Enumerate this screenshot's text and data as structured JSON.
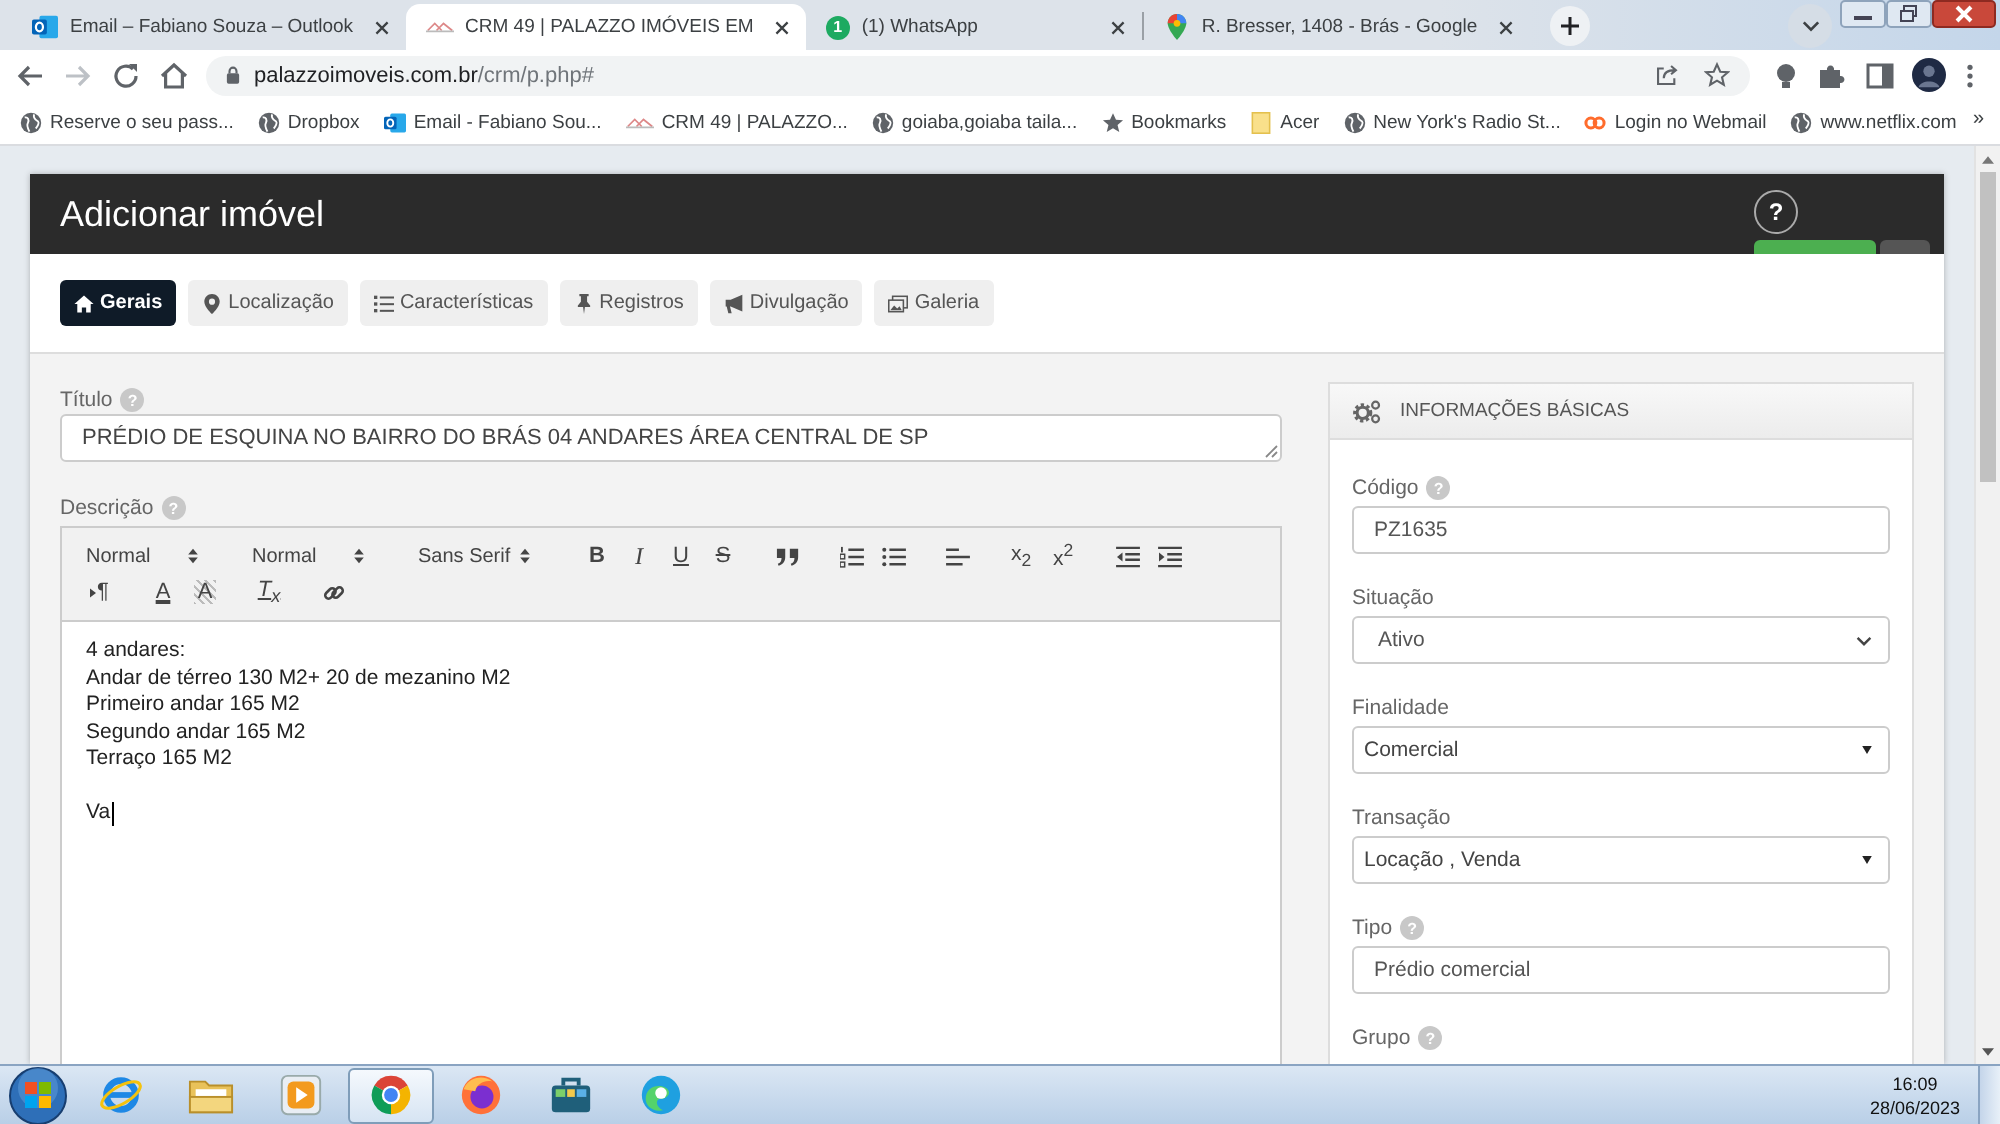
{
  "browser": {
    "tabs": [
      {
        "title": "Email – Fabiano Souza – Outlook",
        "selected": false
      },
      {
        "title": "CRM 49 | PALAZZO IMÓVEIS EM",
        "selected": true
      },
      {
        "title": "(1) WhatsApp",
        "selected": false,
        "badge": "1"
      },
      {
        "title": "R. Bresser, 1408 - Brás - Google",
        "selected": false
      }
    ],
    "url": {
      "host": "palazzoimoveis.com.br",
      "path": "/crm/p.php#"
    },
    "bookmarks": [
      {
        "label": "Reserve o seu pass..."
      },
      {
        "label": "Dropbox"
      },
      {
        "label": "Email - Fabiano Sou..."
      },
      {
        "label": "CRM 49 | PALAZZO..."
      },
      {
        "label": "goiaba,goiaba taila..."
      },
      {
        "label": "Bookmarks"
      },
      {
        "label": "Acer"
      },
      {
        "label": "New York's Radio St..."
      },
      {
        "label": "Login no Webmail"
      },
      {
        "label": "www.netflix.com"
      }
    ],
    "more_bookmarks": "»"
  },
  "modal": {
    "title": "Adicionar imóvel",
    "help": "?",
    "tabs": [
      {
        "label": "Gerais",
        "selected": true
      },
      {
        "label": "Localização",
        "selected": false
      },
      {
        "label": "Características",
        "selected": false
      },
      {
        "label": "Registros",
        "selected": false
      },
      {
        "label": "Divulgação",
        "selected": false
      },
      {
        "label": "Galeria",
        "selected": false
      }
    ]
  },
  "form": {
    "title_field": {
      "label": "Título",
      "help": "?",
      "value": "PRÉDIO DE ESQUINA NO BAIRRO DO BRÁS 04 ANDARES ÁREA CENTRAL DE SP"
    },
    "description": {
      "label": "Descrição",
      "help": "?",
      "toolbar_rows": [
        [
          [
            {
              "kind": "picker",
              "label": "Normal"
            }
          ],
          [
            {
              "kind": "picker",
              "label": "Normal"
            }
          ],
          [
            {
              "kind": "picker",
              "label": "Sans Serif"
            }
          ],
          [
            {
              "kind": "bold",
              "label": "B"
            },
            {
              "kind": "italic",
              "label": "I"
            },
            {
              "kind": "underline",
              "label": "U"
            },
            {
              "kind": "strike",
              "label": "S"
            }
          ],
          [
            {
              "kind": "blockquote"
            }
          ],
          [
            {
              "kind": "list-ordered"
            },
            {
              "kind": "list-bullet"
            }
          ],
          [
            {
              "kind": "align"
            }
          ],
          [
            {
              "kind": "subscript",
              "label": "x$_{2}$"
            },
            {
              "kind": "superscript",
              "label": "x$^{2}$"
            }
          ],
          [
            {
              "kind": "outdent"
            },
            {
              "kind": "indent"
            }
          ]
        ],
        [
          [
            {
              "kind": "direction",
              "label": "¶"
            }
          ],
          [
            {
              "kind": "color",
              "label": "A"
            },
            {
              "kind": "background",
              "label": "A"
            }
          ],
          [
            {
              "kind": "clean",
              "label": "T$_{x}$"
            }
          ],
          [
            {
              "kind": "link"
            }
          ]
        ]
      ],
      "paragraphs": [
        [
          "4 andares:",
          "Andar de térreo 130 M2+ 20 de mezanino M2",
          "Primeiro andar 165 M2",
          "Segundo andar 165 M2",
          "Terraço 165 M2"
        ],
        [
          "Va"
        ]
      ],
      "focused": true
    }
  },
  "info_panel": {
    "title": "INFORMAÇÕES BÁSICAS",
    "fields": [
      {
        "label": "Código",
        "help": "?",
        "kind": "input",
        "value": "PZ1635"
      },
      {
        "label": "Situação",
        "kind": "select",
        "value": "Ativo"
      },
      {
        "label": "Finalidade",
        "kind": "dropdown",
        "value": "Comercial"
      },
      {
        "label": "Transação",
        "kind": "dropdown",
        "value": "Locação , Venda"
      },
      {
        "label": "Tipo",
        "help": "?",
        "kind": "input",
        "value": "Prédio comercial"
      },
      {
        "label": "Grupo",
        "help": "?"
      }
    ]
  },
  "taskbar": {
    "apps": [
      {
        "selected": false
      },
      {
        "selected": false
      },
      {
        "selected": false
      },
      {
        "selected": true
      },
      {
        "selected": false
      },
      {
        "selected": false
      },
      {
        "selected": false
      }
    ],
    "time": "16:09",
    "date": "28/06/2023"
  }
}
